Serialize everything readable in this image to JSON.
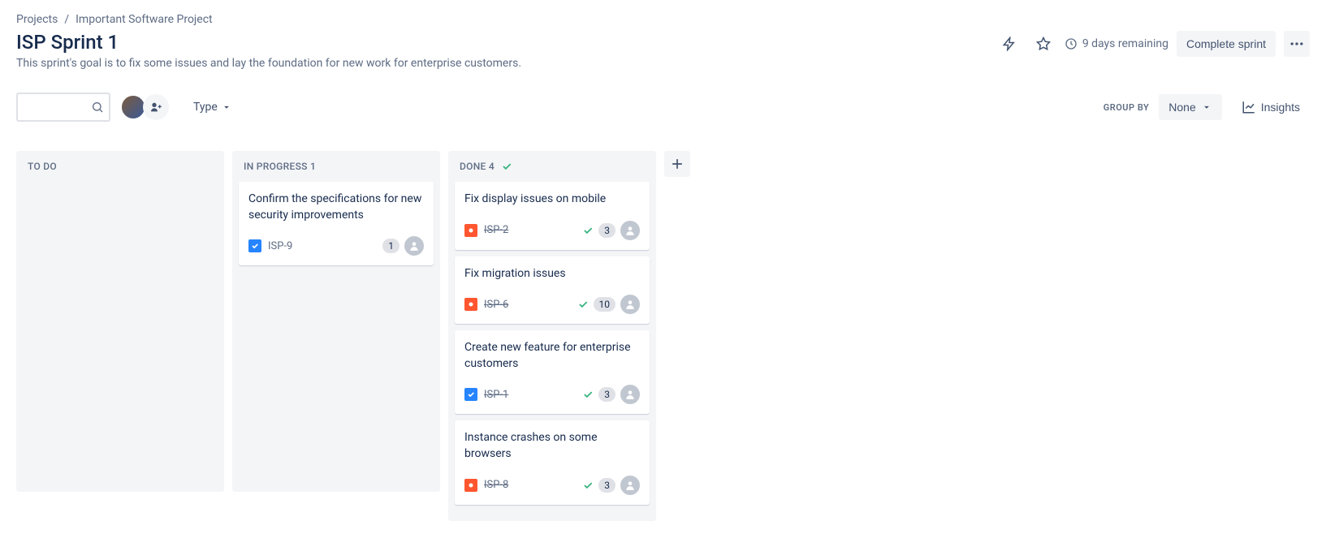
{
  "breadcrumb": {
    "root": "Projects",
    "project": "Important Software Project"
  },
  "sprint": {
    "title": "ISP Sprint 1",
    "goal": "This sprint's goal is to fix some issues and lay the foundation for new work for enterprise customers.",
    "remaining": "9 days remaining",
    "complete_label": "Complete sprint"
  },
  "toolbar": {
    "type_label": "Type",
    "groupby_label": "GROUP BY",
    "groupby_value": "None",
    "insights_label": "Insights",
    "search_placeholder": ""
  },
  "columns": [
    {
      "id": "todo",
      "name": "TO DO",
      "count_text": "",
      "done": false,
      "cards": []
    },
    {
      "id": "inprogress",
      "name": "IN PROGRESS",
      "count_text": "1",
      "done": false,
      "cards": [
        {
          "title": "Confirm the specifications for new security improvements",
          "key": "ISP-9",
          "type": "task",
          "done": false,
          "estimate": "1"
        }
      ]
    },
    {
      "id": "done",
      "name": "DONE",
      "count_text": "4",
      "done": true,
      "cards": [
        {
          "title": "Fix display issues on mobile",
          "key": "ISP-2",
          "type": "bug",
          "done": true,
          "estimate": "3"
        },
        {
          "title": "Fix migration issues",
          "key": "ISP-6",
          "type": "bug",
          "done": true,
          "estimate": "10"
        },
        {
          "title": "Create new feature for enterprise customers",
          "key": "ISP-1",
          "type": "task",
          "done": true,
          "estimate": "3"
        },
        {
          "title": "Instance crashes on some browsers",
          "key": "ISP-8",
          "type": "bug",
          "done": true,
          "estimate": "3"
        }
      ]
    }
  ]
}
